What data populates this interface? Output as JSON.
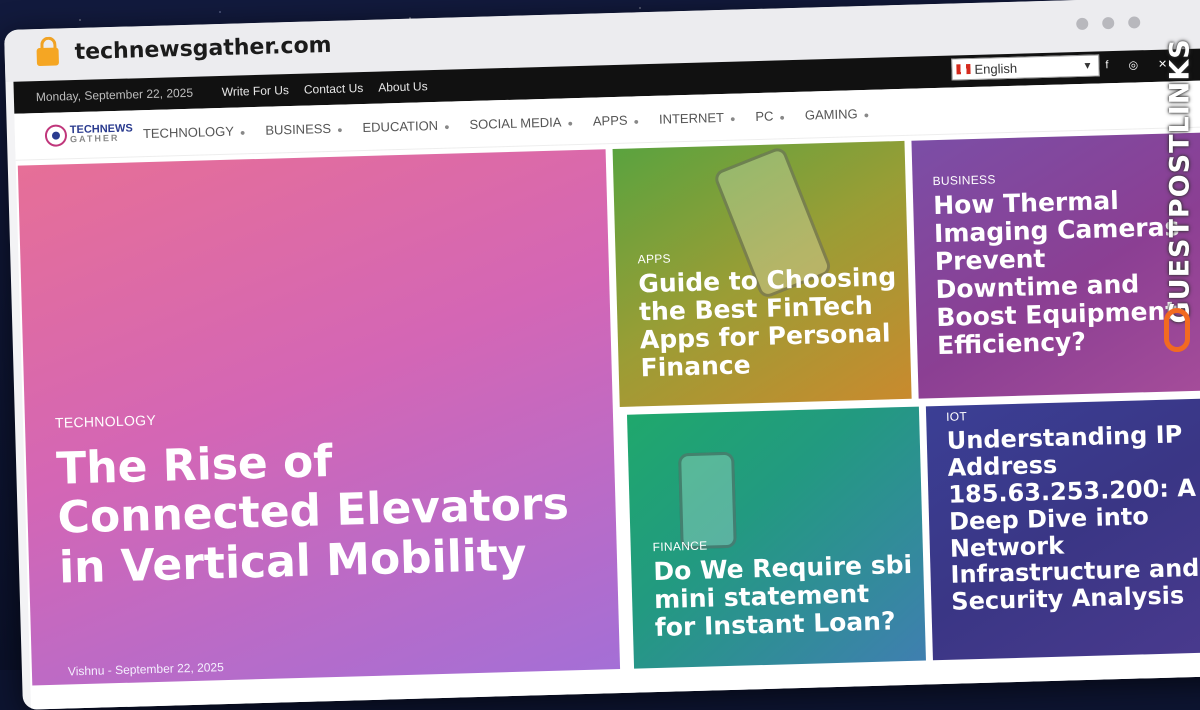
{
  "browser": {
    "url": "technewsgather.com"
  },
  "topbar": {
    "date": "Monday, September 22, 2025",
    "links": [
      "Write For Us",
      "Contact Us",
      "About Us"
    ],
    "language": "English",
    "social_icons": [
      "facebook-icon",
      "instagram-icon",
      "x-icon"
    ]
  },
  "logo": {
    "line1": "TECHNEWS",
    "line2": "GATHER"
  },
  "menu": [
    "TECHNOLOGY",
    "BUSINESS",
    "EDUCATION",
    "SOCIAL MEDIA",
    "APPS",
    "INTERNET",
    "PC",
    "GAMING"
  ],
  "featured": {
    "category": "TECHNOLOGY",
    "title": "The Rise of Connected Elevators in Vertical Mobility",
    "author": "Vishnu",
    "date": "September 22, 2025"
  },
  "tiles": [
    {
      "category": "APPS",
      "title": "Guide to Choosing the Best FinTech Apps for Personal Finance"
    },
    {
      "category": "BUSINESS",
      "title": "How Thermal Imaging Cameras Prevent Downtime and Boost Equipment Efficiency?"
    },
    {
      "category": "FINANCE",
      "title": "Do We Require sbi mini statement for Instant Loan?"
    },
    {
      "category": "IOT",
      "title": "Understanding IP Address 185.63.253.200: A Deep Dive into Network Infrastructure and Security Analysis"
    }
  ],
  "watermark": {
    "text": "GUESTPOSTLINKS"
  },
  "colors": {
    "watermark_accent": "#f26a21",
    "topbar_bg": "#111111"
  }
}
